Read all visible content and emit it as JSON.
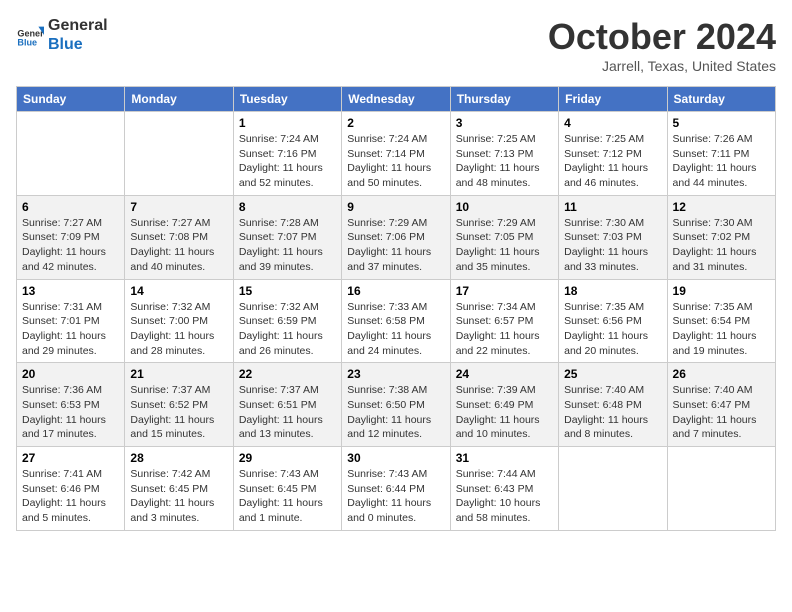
{
  "header": {
    "logo": {
      "general": "General",
      "blue": "Blue"
    },
    "month": "October 2024",
    "location": "Jarrell, Texas, United States"
  },
  "weekdays": [
    "Sunday",
    "Monday",
    "Tuesday",
    "Wednesday",
    "Thursday",
    "Friday",
    "Saturday"
  ],
  "weeks": [
    [
      {
        "day": null
      },
      {
        "day": null
      },
      {
        "day": "1",
        "sunrise": "7:24 AM",
        "sunset": "7:16 PM",
        "daylight": "11 hours and 52 minutes."
      },
      {
        "day": "2",
        "sunrise": "7:24 AM",
        "sunset": "7:14 PM",
        "daylight": "11 hours and 50 minutes."
      },
      {
        "day": "3",
        "sunrise": "7:25 AM",
        "sunset": "7:13 PM",
        "daylight": "11 hours and 48 minutes."
      },
      {
        "day": "4",
        "sunrise": "7:25 AM",
        "sunset": "7:12 PM",
        "daylight": "11 hours and 46 minutes."
      },
      {
        "day": "5",
        "sunrise": "7:26 AM",
        "sunset": "7:11 PM",
        "daylight": "11 hours and 44 minutes."
      }
    ],
    [
      {
        "day": "6",
        "sunrise": "7:27 AM",
        "sunset": "7:09 PM",
        "daylight": "11 hours and 42 minutes."
      },
      {
        "day": "7",
        "sunrise": "7:27 AM",
        "sunset": "7:08 PM",
        "daylight": "11 hours and 40 minutes."
      },
      {
        "day": "8",
        "sunrise": "7:28 AM",
        "sunset": "7:07 PM",
        "daylight": "11 hours and 39 minutes."
      },
      {
        "day": "9",
        "sunrise": "7:29 AM",
        "sunset": "7:06 PM",
        "daylight": "11 hours and 37 minutes."
      },
      {
        "day": "10",
        "sunrise": "7:29 AM",
        "sunset": "7:05 PM",
        "daylight": "11 hours and 35 minutes."
      },
      {
        "day": "11",
        "sunrise": "7:30 AM",
        "sunset": "7:03 PM",
        "daylight": "11 hours and 33 minutes."
      },
      {
        "day": "12",
        "sunrise": "7:30 AM",
        "sunset": "7:02 PM",
        "daylight": "11 hours and 31 minutes."
      }
    ],
    [
      {
        "day": "13",
        "sunrise": "7:31 AM",
        "sunset": "7:01 PM",
        "daylight": "11 hours and 29 minutes."
      },
      {
        "day": "14",
        "sunrise": "7:32 AM",
        "sunset": "7:00 PM",
        "daylight": "11 hours and 28 minutes."
      },
      {
        "day": "15",
        "sunrise": "7:32 AM",
        "sunset": "6:59 PM",
        "daylight": "11 hours and 26 minutes."
      },
      {
        "day": "16",
        "sunrise": "7:33 AM",
        "sunset": "6:58 PM",
        "daylight": "11 hours and 24 minutes."
      },
      {
        "day": "17",
        "sunrise": "7:34 AM",
        "sunset": "6:57 PM",
        "daylight": "11 hours and 22 minutes."
      },
      {
        "day": "18",
        "sunrise": "7:35 AM",
        "sunset": "6:56 PM",
        "daylight": "11 hours and 20 minutes."
      },
      {
        "day": "19",
        "sunrise": "7:35 AM",
        "sunset": "6:54 PM",
        "daylight": "11 hours and 19 minutes."
      }
    ],
    [
      {
        "day": "20",
        "sunrise": "7:36 AM",
        "sunset": "6:53 PM",
        "daylight": "11 hours and 17 minutes."
      },
      {
        "day": "21",
        "sunrise": "7:37 AM",
        "sunset": "6:52 PM",
        "daylight": "11 hours and 15 minutes."
      },
      {
        "day": "22",
        "sunrise": "7:37 AM",
        "sunset": "6:51 PM",
        "daylight": "11 hours and 13 minutes."
      },
      {
        "day": "23",
        "sunrise": "7:38 AM",
        "sunset": "6:50 PM",
        "daylight": "11 hours and 12 minutes."
      },
      {
        "day": "24",
        "sunrise": "7:39 AM",
        "sunset": "6:49 PM",
        "daylight": "11 hours and 10 minutes."
      },
      {
        "day": "25",
        "sunrise": "7:40 AM",
        "sunset": "6:48 PM",
        "daylight": "11 hours and 8 minutes."
      },
      {
        "day": "26",
        "sunrise": "7:40 AM",
        "sunset": "6:47 PM",
        "daylight": "11 hours and 7 minutes."
      }
    ],
    [
      {
        "day": "27",
        "sunrise": "7:41 AM",
        "sunset": "6:46 PM",
        "daylight": "11 hours and 5 minutes."
      },
      {
        "day": "28",
        "sunrise": "7:42 AM",
        "sunset": "6:45 PM",
        "daylight": "11 hours and 3 minutes."
      },
      {
        "day": "29",
        "sunrise": "7:43 AM",
        "sunset": "6:45 PM",
        "daylight": "11 hours and 1 minute."
      },
      {
        "day": "30",
        "sunrise": "7:43 AM",
        "sunset": "6:44 PM",
        "daylight": "11 hours and 0 minutes."
      },
      {
        "day": "31",
        "sunrise": "7:44 AM",
        "sunset": "6:43 PM",
        "daylight": "10 hours and 58 minutes."
      },
      {
        "day": null
      },
      {
        "day": null
      }
    ]
  ],
  "labels": {
    "sunrise": "Sunrise:",
    "sunset": "Sunset:",
    "daylight": "Daylight:"
  }
}
